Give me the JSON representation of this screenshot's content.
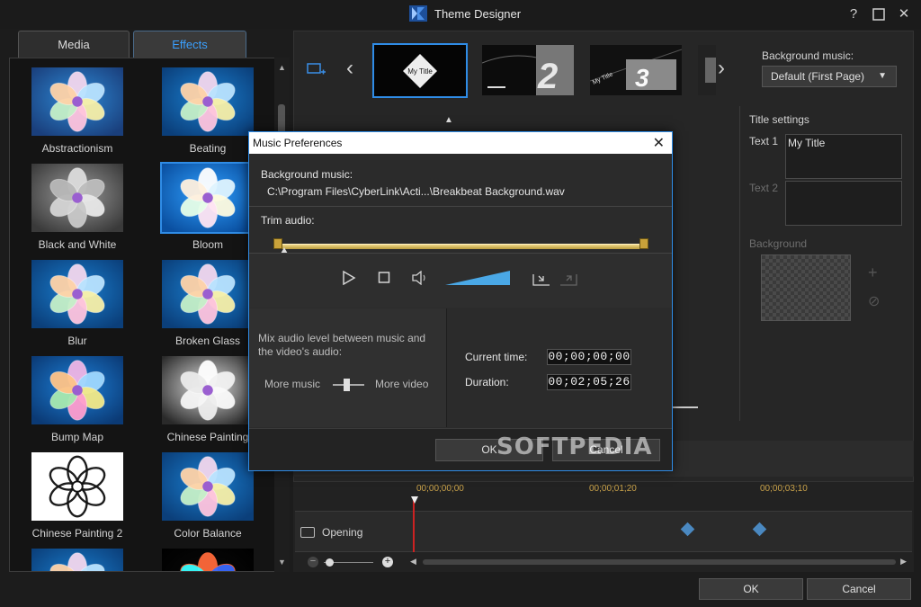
{
  "window": {
    "title": "Theme Designer",
    "help_icon": "question-mark-icon",
    "maximize_icon": "maximize-icon",
    "close_icon": "close-icon"
  },
  "left_panel": {
    "tabs": [
      {
        "label": "Media",
        "active": false
      },
      {
        "label": "Effects",
        "active": true
      }
    ],
    "effects": [
      {
        "label": "Abstractionism",
        "style": "abstract"
      },
      {
        "label": "Beating",
        "style": "blue"
      },
      {
        "label": "Black and White",
        "style": "gray"
      },
      {
        "label": "Bloom",
        "style": "bloom",
        "selected": true
      },
      {
        "label": "Blur",
        "style": "blue"
      },
      {
        "label": "Broken Glass",
        "style": "blue"
      },
      {
        "label": "Bump Map",
        "style": "bump"
      },
      {
        "label": "Chinese Painting",
        "style": "chinese"
      },
      {
        "label": "Chinese Painting 2",
        "style": "ink"
      },
      {
        "label": "Color Balance",
        "style": "blue"
      },
      {
        "label": "",
        "style": "blue"
      },
      {
        "label": "",
        "style": "dark"
      }
    ]
  },
  "slides": {
    "items": [
      {
        "label": "My Title",
        "selected": true
      },
      {
        "label": "2"
      },
      {
        "label": "3",
        "sub": "My Title"
      }
    ]
  },
  "background_music": {
    "label": "Background music:",
    "value": "Default (First Page)"
  },
  "title_settings": {
    "heading": "Title settings",
    "text1_label": "Text 1",
    "text1_value": "My Title",
    "text2_label": "Text 2",
    "text2_value": "",
    "background_label": "Background"
  },
  "timeline": {
    "marks": [
      "00;00;00;00",
      "00;00;01;20",
      "00;00;03;10"
    ],
    "track_label": "Opening"
  },
  "footer": {
    "ok": "OK",
    "cancel": "Cancel"
  },
  "dialog": {
    "title": "Music Preferences",
    "bg_music_label": "Background music:",
    "bg_music_path": "C:\\Program Files\\CyberLink\\Acti...\\Breakbeat Background.wav",
    "trim_label": "Trim audio:",
    "mix_text_1": "Mix audio level between music and",
    "mix_text_2": "the video's audio:",
    "more_music": "More music",
    "more_video": "More video",
    "current_time_label": "Current time:",
    "current_time": "00;00;00;00",
    "duration_label": "Duration:",
    "duration": "00;02;05;26",
    "ok": "OK",
    "cancel": "Cancel"
  },
  "watermark": "SOFTPEDIA"
}
